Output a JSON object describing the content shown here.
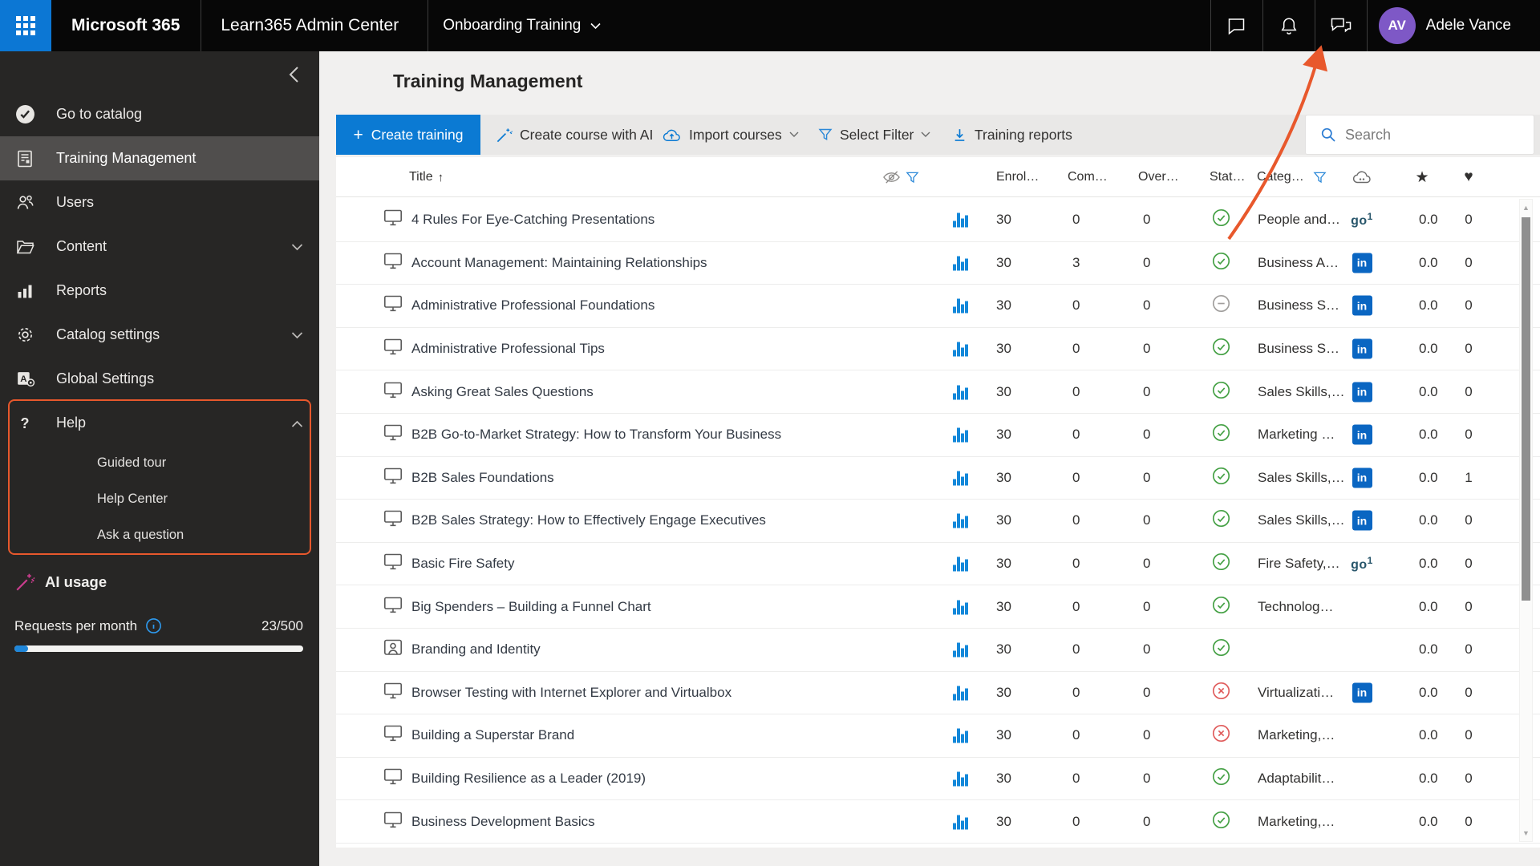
{
  "colors": {
    "accent": "#0078d4",
    "annotation_orange": "#e8582c",
    "status_green": "#44a044",
    "status_red": "#e05c5c",
    "status_gray": "#a19f9d",
    "linkedin_blue": "#0a66c2",
    "go1_navy": "#28566b",
    "avatar_purple": "#7e58c6",
    "ai_magenta": "#cc3d8f"
  },
  "topbar": {
    "brand": "Microsoft 365",
    "app_name": "Learn365 Admin Center",
    "context": "Onboarding Training",
    "icons": [
      "chat-icon",
      "bell-icon",
      "feedback-icon"
    ],
    "user": {
      "initials": "AV",
      "name": "Adele Vance"
    }
  },
  "sidebar": {
    "items": [
      {
        "id": "go-to-catalog",
        "label": "Go to catalog",
        "icon": "catalog-check-icon"
      },
      {
        "id": "training-management",
        "label": "Training Management",
        "icon": "document-icon",
        "selected": true
      },
      {
        "id": "users",
        "label": "Users",
        "icon": "users-icon"
      },
      {
        "id": "content",
        "label": "Content",
        "icon": "folder-icon",
        "chevron": "down"
      },
      {
        "id": "reports",
        "label": "Reports",
        "icon": "bar-chart-icon"
      },
      {
        "id": "catalog-settings",
        "label": "Catalog settings",
        "icon": "gear-icon",
        "chevron": "down"
      },
      {
        "id": "global-settings",
        "label": "Global Settings",
        "icon": "admin-icon"
      },
      {
        "id": "help",
        "label": "Help",
        "icon": "question-icon",
        "chevron": "up"
      },
      {
        "id": "guided-tour",
        "label": "Guided tour",
        "child": true
      },
      {
        "id": "help-center",
        "label": "Help Center",
        "child": true
      },
      {
        "id": "ask-a-question",
        "label": "Ask a question",
        "child": true
      }
    ],
    "ai_usage": {
      "title": "AI usage",
      "requests_label": "Requests per month",
      "usage": "23/500",
      "progress_percent": 4.6
    }
  },
  "main": {
    "page_title": "Training Management",
    "toolbar": {
      "create_training": "Create training",
      "create_course_ai": "Create course with AI",
      "import_courses": "Import courses",
      "select_filter": "Select Filter",
      "training_reports": "Training reports",
      "search_placeholder": "Search"
    },
    "table": {
      "headers": {
        "title": "Title",
        "enrolled": "Enrol…",
        "completed": "Com…",
        "overdue": "Over…",
        "status": "Stat…",
        "category": "Categ…"
      },
      "rows": [
        {
          "title": "4 Rules For Eye-Catching Presentations",
          "title_icon": "monitor",
          "enrolled": "30",
          "completed": "0",
          "overdue": "0",
          "status": "check",
          "category": "People and…",
          "provider": "go1",
          "rating": "0.0",
          "likes": "0"
        },
        {
          "title": "Account Management: Maintaining Relationships",
          "title_icon": "monitor",
          "enrolled": "30",
          "completed": "3",
          "overdue": "0",
          "status": "check",
          "category": "Business A…",
          "provider": "linkedin",
          "rating": "0.0",
          "likes": "0"
        },
        {
          "title": "Administrative Professional Foundations",
          "title_icon": "monitor",
          "enrolled": "30",
          "completed": "0",
          "overdue": "0",
          "status": "minus",
          "category": "Business S…",
          "provider": "linkedin",
          "rating": "0.0",
          "likes": "0"
        },
        {
          "title": "Administrative Professional Tips",
          "title_icon": "monitor",
          "enrolled": "30",
          "completed": "0",
          "overdue": "0",
          "status": "check",
          "category": "Business S…",
          "provider": "linkedin",
          "rating": "0.0",
          "likes": "0"
        },
        {
          "title": "Asking Great Sales Questions",
          "title_icon": "monitor",
          "enrolled": "30",
          "completed": "0",
          "overdue": "0",
          "status": "check",
          "category": "Sales Skills,…",
          "provider": "linkedin",
          "rating": "0.0",
          "likes": "0"
        },
        {
          "title": "B2B Go-to-Market Strategy: How to Transform Your Business",
          "title_icon": "monitor",
          "enrolled": "30",
          "completed": "0",
          "overdue": "0",
          "status": "check",
          "category": "Marketing …",
          "provider": "linkedin",
          "rating": "0.0",
          "likes": "0"
        },
        {
          "title": "B2B Sales Foundations",
          "title_icon": "monitor",
          "enrolled": "30",
          "completed": "0",
          "overdue": "0",
          "status": "check",
          "category": "Sales Skills,…",
          "provider": "linkedin",
          "rating": "0.0",
          "likes": "1"
        },
        {
          "title": "B2B Sales Strategy: How to Effectively Engage Executives",
          "title_icon": "monitor",
          "enrolled": "30",
          "completed": "0",
          "overdue": "0",
          "status": "check",
          "category": "Sales Skills,…",
          "provider": "linkedin",
          "rating": "0.0",
          "likes": "0"
        },
        {
          "title": "Basic Fire Safety",
          "title_icon": "monitor",
          "enrolled": "30",
          "completed": "0",
          "overdue": "0",
          "status": "check",
          "category": "Fire Safety,…",
          "provider": "go1",
          "rating": "0.0",
          "likes": "0"
        },
        {
          "title": "Big Spenders – Building a Funnel Chart",
          "title_icon": "monitor",
          "enrolled": "30",
          "completed": "0",
          "overdue": "0",
          "status": "check",
          "category": "Technolog…",
          "provider": "",
          "rating": "0.0",
          "likes": "0"
        },
        {
          "title": "Branding and Identity",
          "title_icon": "person",
          "enrolled": "30",
          "completed": "0",
          "overdue": "0",
          "status": "check",
          "category": "",
          "provider": "",
          "rating": "0.0",
          "likes": "0"
        },
        {
          "title": "Browser Testing with Internet Explorer and Virtualbox",
          "title_icon": "monitor",
          "enrolled": "30",
          "completed": "0",
          "overdue": "0",
          "status": "x",
          "category": "Virtualizati…",
          "provider": "linkedin",
          "rating": "0.0",
          "likes": "0"
        },
        {
          "title": "Building a Superstar Brand",
          "title_icon": "monitor",
          "enrolled": "30",
          "completed": "0",
          "overdue": "0",
          "status": "x",
          "category": "Marketing,…",
          "provider": "",
          "rating": "0.0",
          "likes": "0"
        },
        {
          "title": "Building Resilience as a Leader (2019)",
          "title_icon": "monitor",
          "enrolled": "30",
          "completed": "0",
          "overdue": "0",
          "status": "check",
          "category": "Adaptabilit…",
          "provider": "",
          "rating": "0.0",
          "likes": "0"
        },
        {
          "title": "Business Development Basics",
          "title_icon": "monitor",
          "enrolled": "30",
          "completed": "0",
          "overdue": "0",
          "status": "check",
          "category": "Marketing,…",
          "provider": "",
          "rating": "0.0",
          "likes": "0"
        }
      ]
    }
  }
}
